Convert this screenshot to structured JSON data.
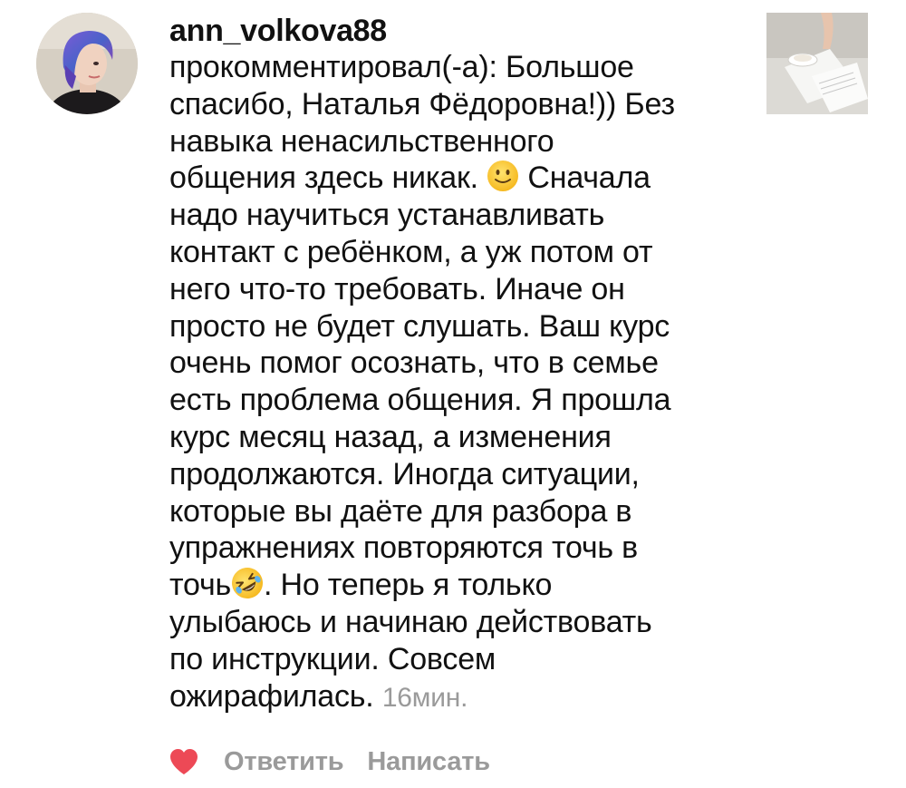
{
  "comment": {
    "username": "ann_volkova88",
    "lines": [
      "прокомментировал(-а): Большое",
      "спасибо, Наталья Фёдоровна!)) Без",
      "навыка ненасильственного",
      "общения здесь никак. ",
      " Сначала",
      "надо научиться устанавливать",
      "контакт с ребёнком, а уж потом от",
      "него что-то требовать. Иначе он",
      "просто не будет слушать. Ваш курс",
      "очень помог осознать, что в семье",
      "есть проблема общения. Я прошла",
      "курс месяц назад, а изменения",
      "продолжаются. Иногда ситуации,",
      "которые вы даёте для разбора в",
      "упражнениях повторяются точь в",
      "точь",
      ". Но теперь я только",
      "улыбаюсь и начинаю действовать",
      "по инструкции. Совсем",
      "ожирафилась. "
    ],
    "timestamp": "16мин.",
    "emojis": [
      "slightly-smiling-face-emoji",
      "rolling-on-the-floor-laughing-emoji"
    ]
  },
  "actions": {
    "like_icon": "heart-icon",
    "like_color": "#ed4956",
    "reply_label": "Ответить",
    "message_label": "Написать"
  },
  "avatar": {
    "icon": "user-avatar"
  },
  "post_thumbnail": {
    "icon": "post-thumbnail"
  }
}
